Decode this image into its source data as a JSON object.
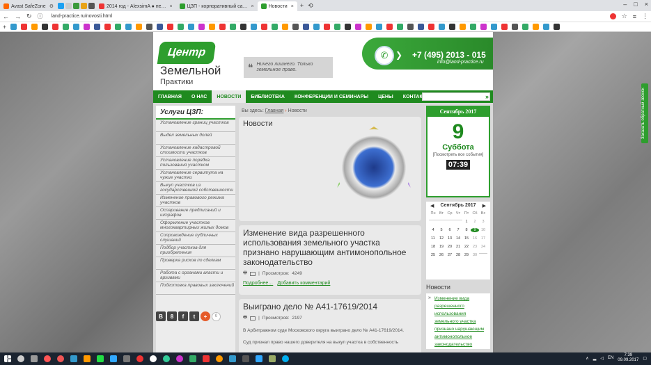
{
  "browser": {
    "tabs": [
      {
        "label": "Avast SafeZone"
      },
      {
        "label": "2014 год - AlexsimA ● пе…"
      },
      {
        "label": "ЦЗП - корпоративный са…"
      },
      {
        "label": "Новости",
        "active": true
      }
    ],
    "address": "land-practice.ru/novosti.html"
  },
  "site": {
    "logo": {
      "line1": "Центр",
      "line2": "Земельной",
      "line3": "Практики"
    },
    "slogan": "Ничего лишнего. Только земельное право.",
    "phone": "+7 (495) 2013 - 015",
    "email": "info@land-practice.ru",
    "menu": [
      "ГЛАВНАЯ",
      "О НАС",
      "НОВОСТИ",
      "БИБЛИОТЕКА",
      "КОНФЕРЕНЦИИ И СЕМИНАРЫ",
      "ЦЕНЫ",
      "КОНТАКТЫ"
    ],
    "callback_tab": "Заказать обратный звонок"
  },
  "left": {
    "title": "Услуги ЦЗП:",
    "services": [
      "Установление границ участков",
      "Выдел земельных долей",
      "Установление кадастровой стоимости участков",
      "Установление порядка пользования участком",
      "Установление сервитута на чужие участки",
      "Выкуп участков из государственной собственности",
      "Изменение правового режима участков",
      "Оспаривание предписаний и штрафов",
      "Оформление участков многоквартирных жилых домов",
      "Сопровождение публичных слушаний",
      "Подбор участков для приобретения",
      "Проверка рисков по сделкам",
      "Работа с органами власти и архивами",
      "Подготовка правовых заключений"
    ],
    "social": [
      "В",
      "8",
      "f",
      "t",
      "+"
    ],
    "share_count": "0"
  },
  "center": {
    "breadcrumb": {
      "prefix": "Вы здесь:",
      "home": "Главная",
      "sep": "›",
      "current": "Новости"
    },
    "page_title": "Новости",
    "articles": [
      {
        "title": "Изменение вида разрешенного использования земельного участка признано нарушающим антимонопольное законодательство",
        "views_label": "Просмотров:",
        "views": "4249",
        "more": "Подробнее…",
        "comment": "Добавить комментарий"
      },
      {
        "title": "Выиграно дело № А41-17619/2014",
        "views_label": "Просмотров:",
        "views": "2197",
        "body1": "В Арбитражном суде Московского округа выиграно дело № А41-17619/2014.",
        "body2": "Суд признал право нашего доверителя на выкуп участка в собственность"
      }
    ]
  },
  "right": {
    "month_header": "Сентябрь 2017",
    "day": "9",
    "weekday": "Суббота",
    "all_events": "[Посмотреть все события]",
    "clock": "07:39",
    "calendar": {
      "title": "Сентябрь 2017",
      "weekdays": [
        "Пн",
        "Вт",
        "Ср",
        "Чт",
        "Пт",
        "Сб",
        "Вс"
      ],
      "days": [
        "",
        "",
        "",
        "",
        "1",
        "2",
        "3",
        "4",
        "5",
        "6",
        "7",
        "8",
        "9",
        "10",
        "11",
        "12",
        "13",
        "14",
        "15",
        "16",
        "17",
        "18",
        "19",
        "20",
        "21",
        "22",
        "23",
        "24",
        "25",
        "26",
        "27",
        "28",
        "29",
        "30",
        ""
      ],
      "today": "9"
    },
    "news_title": "Новости",
    "news_link": "Изменение вида разрешенного использования земельного участка признано нарушающим антимонопольное законодательство"
  },
  "taskbar": {
    "lang": "EN",
    "time": "7:39",
    "date": "09.09.2017"
  },
  "colors": {
    "brand_green": "#2e9e2e",
    "menu_green": "#1f8a1f"
  }
}
